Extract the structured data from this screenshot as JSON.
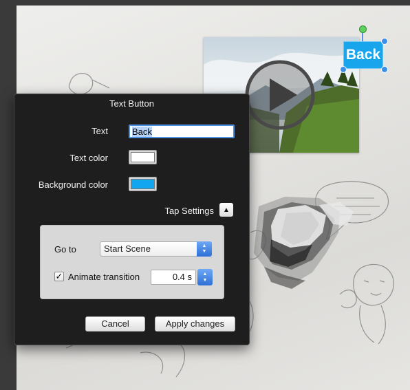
{
  "canvas": {
    "back_button_label": "Back"
  },
  "dialog": {
    "title": "Text Button",
    "text_label": "Text",
    "text_value": "Back",
    "text_color_label": "Text color",
    "text_color": "#ffffff",
    "background_color_label": "Background color",
    "background_color": "#12a6f0",
    "tap_settings_label": "Tap Settings",
    "tap_settings_toggle_icon": "chevron-up-icon",
    "goto_label": "Go to",
    "goto_value": "Start Scene",
    "animate_label": "Animate transition",
    "animate_checked": true,
    "duration_value": "0.4 s",
    "cancel_label": "Cancel",
    "apply_label": "Apply changes"
  },
  "colors": {
    "accent": "#3d8fe8",
    "dialog_bg": "#1e1e1e",
    "back_button_bg": "#19a5ec"
  }
}
